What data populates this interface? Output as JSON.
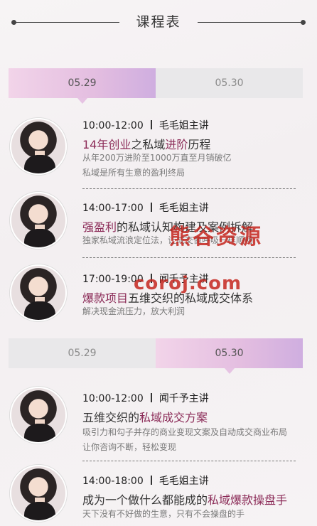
{
  "header": {
    "title": "课程表"
  },
  "section1": {
    "tabs": [
      {
        "label": "05.29",
        "active": true
      },
      {
        "label": "05.30",
        "active": false
      }
    ],
    "items": [
      {
        "time": "10:00-12:00",
        "speaker": "毛毛姐主讲",
        "topic_parts": [
          {
            "text": "14年",
            "hl": true
          },
          {
            "text": "创业",
            "hl": true
          },
          {
            "text": "之私域",
            "hl": false
          },
          {
            "text": "进阶",
            "hl": true
          },
          {
            "text": "历程",
            "hl": false
          }
        ],
        "desc": [
          "从年200万进阶至1000万直至月销破亿",
          "私域是所有生意的盈利终局"
        ]
      },
      {
        "time": "14:00-17:00",
        "speaker": "毛毛姐主讲",
        "topic_parts": [
          {
            "text": "强盈利",
            "hl": true
          },
          {
            "text": "的私域认知构建及案例拆解",
            "hl": false
          }
        ],
        "desc": [
          "独家私域流浪定位法，让成交像呼吸一样顺畅"
        ]
      },
      {
        "time": "17:00-19:00",
        "speaker": "闻千予主讲",
        "topic_parts": [
          {
            "text": "爆款项目",
            "hl": true
          },
          {
            "text": "五维交织的私域成交体系",
            "hl": false
          }
        ],
        "desc": [
          "解决现金流压力，放大利润"
        ]
      }
    ]
  },
  "section2": {
    "tabs": [
      {
        "label": "05.29",
        "active": false
      },
      {
        "label": "05.30",
        "active": true
      }
    ],
    "items": [
      {
        "time": "10:00-12:00",
        "speaker": "闻千予主讲",
        "topic_parts": [
          {
            "text": "五维交织的",
            "hl": false
          },
          {
            "text": "私域成交方案",
            "hl": true
          }
        ],
        "desc": [
          "吸引力和勾子并存的商业变现文案及自动成交商业布局",
          "让你咨询不断，轻松变现"
        ]
      },
      {
        "time": "14:00-18:00",
        "speaker": "毛毛姐主讲",
        "topic_parts": [
          {
            "text": "成为一个做什么都能成的",
            "hl": false
          },
          {
            "text": "私域爆款操盘手",
            "hl": true
          }
        ],
        "desc": [
          "天下没有不好做的生意，只有不会操盘的手"
        ]
      }
    ]
  },
  "watermark": {
    "line1": "熊谷资源",
    "line2": "coroj.com"
  }
}
